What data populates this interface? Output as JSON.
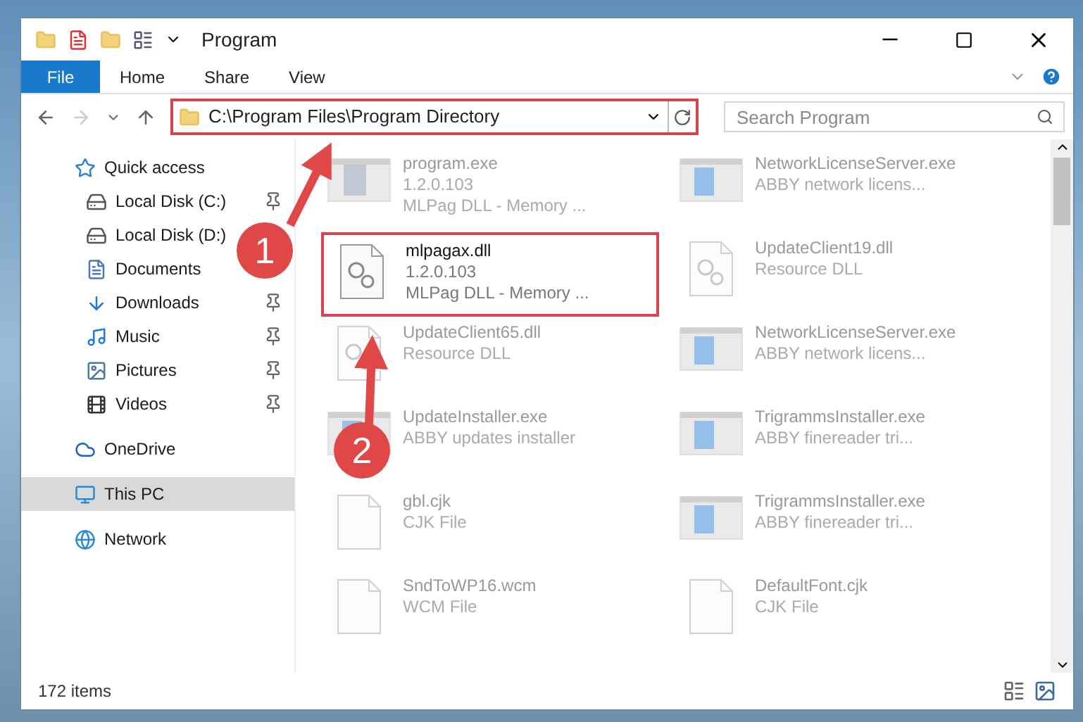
{
  "window": {
    "title": "Program"
  },
  "ribbon_tabs": [
    {
      "label": "File",
      "kind": "file",
      "selected": false
    },
    {
      "label": "Home",
      "kind": "tab",
      "selected": false
    },
    {
      "label": "Share",
      "kind": "tab",
      "selected": false
    },
    {
      "label": "View",
      "kind": "tab",
      "selected": false
    }
  ],
  "address_bar": {
    "path": "C:\\Program Files\\Program Directory",
    "search_placeholder": "Search Program"
  },
  "sidebar": [
    {
      "label": "Quick access",
      "kind": "star",
      "selected": false,
      "children": [
        {
          "label": "Local Disk (C:)",
          "kind": "disk",
          "pinned": true,
          "selected": false
        },
        {
          "label": "Local Disk (D:)",
          "kind": "disk",
          "pinned": false,
          "selected": false
        },
        {
          "label": "Documents",
          "kind": "doc",
          "pinned": false,
          "selected": false
        },
        {
          "label": "Downloads",
          "kind": "download",
          "pinned": true,
          "selected": false
        },
        {
          "label": "Music",
          "kind": "music",
          "pinned": true,
          "selected": false
        },
        {
          "label": "Pictures",
          "kind": "pictures",
          "pinned": true,
          "selected": false
        },
        {
          "label": "Videos",
          "kind": "videos",
          "pinned": true,
          "selected": false
        }
      ]
    },
    {
      "label": "OneDrive",
      "kind": "cloud",
      "selected": false
    },
    {
      "label": "This PC",
      "kind": "pc",
      "selected": true
    },
    {
      "label": "Network",
      "kind": "network",
      "selected": false
    }
  ],
  "files": [
    {
      "kind": "exe-app",
      "faded": true,
      "selected": false,
      "lines": [
        "program.exe",
        "1.2.0.103",
        "MLPag DLL - Memory ..."
      ]
    },
    {
      "kind": "exe",
      "faded": true,
      "selected": false,
      "lines": [
        "NetworkLicenseServer.exe",
        "ABBY network licens..."
      ]
    },
    {
      "kind": "dll",
      "faded": false,
      "selected": true,
      "lines": [
        "mlpagax.dll",
        "1.2.0.103",
        "MLPag DLL - Memory ..."
      ]
    },
    {
      "kind": "dll",
      "faded": true,
      "selected": false,
      "lines": [
        "UpdateClient19.dll",
        "Resource DLL"
      ]
    },
    {
      "kind": "dll",
      "faded": true,
      "selected": false,
      "lines": [
        "UpdateClient65.dll",
        "Resource DLL"
      ]
    },
    {
      "kind": "exe",
      "faded": true,
      "selected": false,
      "lines": [
        "NetworkLicenseServer.exe",
        "ABBY network licens..."
      ]
    },
    {
      "kind": "exe",
      "faded": true,
      "selected": false,
      "lines": [
        "UpdateInstaller.exe",
        "ABBY updates installer"
      ]
    },
    {
      "kind": "exe",
      "faded": true,
      "selected": false,
      "lines": [
        "TrigrammsInstaller.exe",
        "ABBY finereader tri..."
      ]
    },
    {
      "kind": "file",
      "faded": true,
      "selected": false,
      "lines": [
        "gbl.cjk",
        "CJK File"
      ]
    },
    {
      "kind": "exe",
      "faded": true,
      "selected": false,
      "lines": [
        "TrigrammsInstaller.exe",
        "ABBY finereader tri..."
      ]
    },
    {
      "kind": "file",
      "faded": true,
      "selected": false,
      "lines": [
        "SndToWP16.wcm",
        "WCM File"
      ]
    },
    {
      "kind": "file",
      "faded": true,
      "selected": false,
      "lines": [
        "DefaultFont.cjk",
        "CJK File"
      ]
    }
  ],
  "status_bar": {
    "count": "172 items"
  },
  "annotations": [
    {
      "number": "1"
    },
    {
      "number": "2"
    }
  ]
}
